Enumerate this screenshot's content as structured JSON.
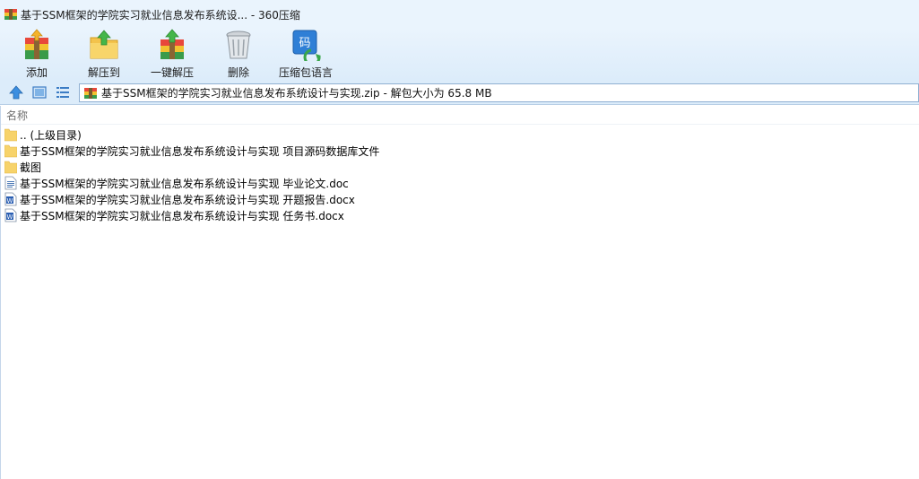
{
  "window": {
    "title": "基于SSM框架的学院实习就业信息发布系统设... - 360压缩"
  },
  "toolbar": {
    "items": [
      {
        "label": "添加",
        "icon": "add-archive-icon"
      },
      {
        "label": "解压到",
        "icon": "extract-to-icon"
      },
      {
        "label": "一键解压",
        "icon": "one-click-extract-icon"
      },
      {
        "label": "删除",
        "icon": "delete-bin-icon"
      },
      {
        "label": "压缩包语言",
        "icon": "archive-language-icon"
      }
    ]
  },
  "navbar": {
    "path": "基于SSM框架的学院实习就业信息发布系统设计与实现.zip - 解包大小为 65.8 MB"
  },
  "list": {
    "column_name": "名称",
    "rows": [
      {
        "name": ".. (上级目录)",
        "type": "folder"
      },
      {
        "name": "基于SSM框架的学院实习就业信息发布系统设计与实现 项目源码数据库文件",
        "type": "folder"
      },
      {
        "name": "截图",
        "type": "folder"
      },
      {
        "name": "基于SSM框架的学院实习就业信息发布系统设计与实现 毕业论文.doc",
        "type": "doc"
      },
      {
        "name": "基于SSM框架的学院实习就业信息发布系统设计与实现 开题报告.docx",
        "type": "word"
      },
      {
        "name": "基于SSM框架的学院实习就业信息发布系统设计与实现 任务书.docx",
        "type": "word"
      }
    ]
  },
  "colors": {
    "chrome_light": "#eaf4fd",
    "chrome_dark": "#dcecfa",
    "folder_yellow": "#f7d36b",
    "accent_blue": "#2f7fd6"
  }
}
